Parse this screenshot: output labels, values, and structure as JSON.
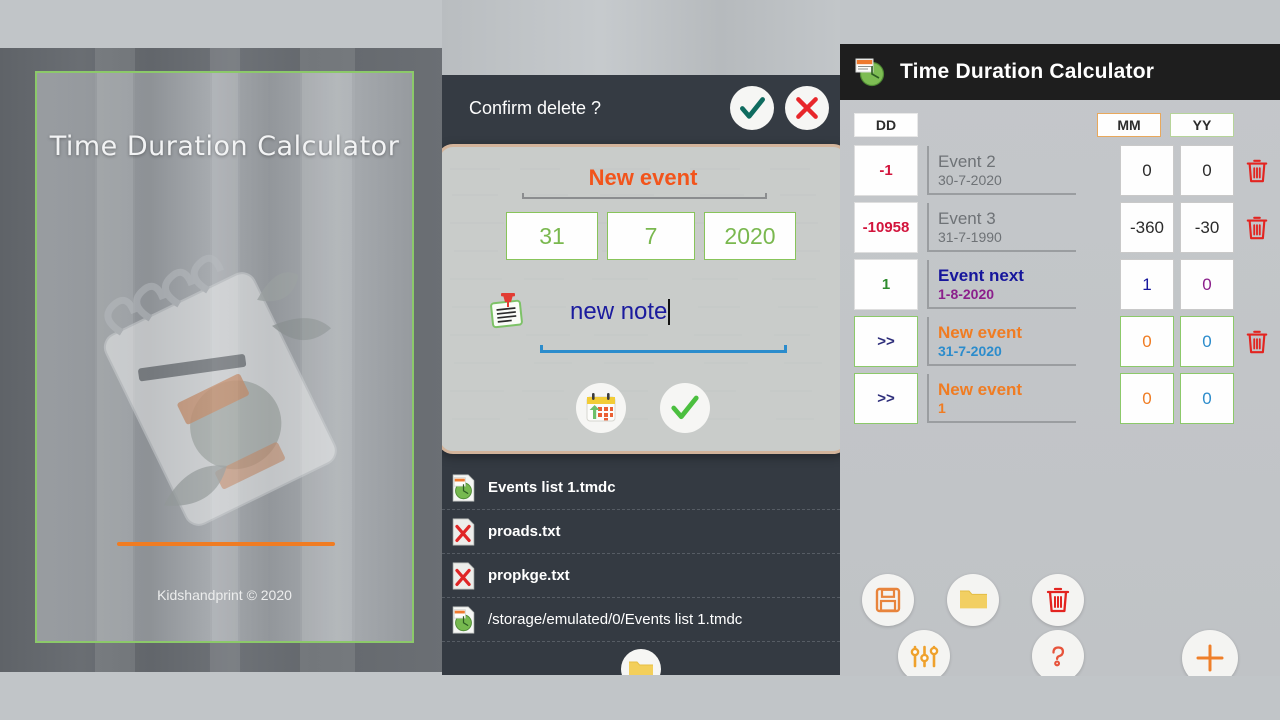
{
  "splash": {
    "title": "Time Duration Calculator",
    "copyright": "Kidshandprint © 2020",
    "border_color": "#8cc96a",
    "bar_color": "#f07c22"
  },
  "middle": {
    "confirm": {
      "message": "Confirm delete ?",
      "accept_icon": "check-icon",
      "reject_icon": "close-icon"
    },
    "dialog": {
      "title": "New event",
      "title_color": "#f2541b",
      "day": "31",
      "month": "7",
      "year": "2020",
      "note_value": "new note",
      "note_icon": "note-pin-icon",
      "calendar_button_icon": "calendar-icon",
      "confirm_button_icon": "check-icon"
    },
    "files": {
      "items": [
        {
          "name": "Events list 1.tmdc",
          "icon": "tmdc-file-icon"
        },
        {
          "name": "proads.txt",
          "icon": "txt-file-icon"
        },
        {
          "name": "propkge.txt",
          "icon": "txt-file-icon"
        },
        {
          "name": "/storage/emulated/0/Events list 1.tmdc",
          "icon": "tmdc-file-icon"
        }
      ],
      "open_button_icon": "folder-icon"
    }
  },
  "right": {
    "app_title": "Time Duration Calculator",
    "app_icon": "app-logo-icon",
    "headers": {
      "dd": "DD",
      "mm": "MM",
      "yy": "YY"
    },
    "rows": [
      {
        "dd": "-1",
        "dd_color": "#d2143c",
        "dd_border": "#dedede",
        "name": "Event 2",
        "name_color": "#6e7276",
        "date": "30-7-2020",
        "date_color": "#6e7276",
        "mm": "0",
        "mm_color": "#2b2b2b",
        "yy": "0",
        "yy_color": "#2b2b2b",
        "box_border": "#c9c9c9",
        "trash": true
      },
      {
        "dd": "-10958",
        "dd_color": "#d2143c",
        "dd_border": "#dedede",
        "name": "Event 3",
        "name_color": "#6e7276",
        "date": "31-7-1990",
        "date_color": "#6e7276",
        "mm": "-360",
        "mm_color": "#2b2b2b",
        "yy": "-30",
        "yy_color": "#2b2b2b",
        "box_border": "#c9c9c9",
        "trash": true
      },
      {
        "dd": "1",
        "dd_color": "#2e8b2e",
        "dd_border": "#dedede",
        "name": "Event next",
        "name_color": "#16169c",
        "date": "1-8-2020",
        "date_color": "#8b1f8b",
        "mm": "1",
        "mm_color": "#16169c",
        "yy": "0",
        "yy_color": "#8b1f8b",
        "box_border": "#c9c9c9",
        "trash": false
      },
      {
        "dd": ">>",
        "dd_color": "#2d2d7a",
        "dd_border": "#8cc96a",
        "name": "New event",
        "name_color": "#f07c22",
        "date": "31-7-2020",
        "date_color": "#2b8ccc",
        "mm": "0",
        "mm_color": "#f07c22",
        "yy": "0",
        "yy_color": "#2b8ccc",
        "box_border": "#8cc96a",
        "trash": true
      },
      {
        "dd": ">>",
        "dd_color": "#2d2d7a",
        "dd_border": "#8cc96a",
        "name": "New event",
        "name_color": "#f07c22",
        "date": "1",
        "date_color": "#f07c22",
        "mm": "0",
        "mm_color": "#f07c22",
        "yy": "0",
        "yy_color": "#2b8ccc",
        "box_border": "#8cc96a",
        "trash": false
      }
    ],
    "actions": {
      "save": "save-icon",
      "open": "folder-icon",
      "delete": "trash-icon",
      "settings": "sliders-icon",
      "help": "question-icon",
      "add": "plus-icon",
      "collapse": "chevron-up-icon"
    }
  }
}
